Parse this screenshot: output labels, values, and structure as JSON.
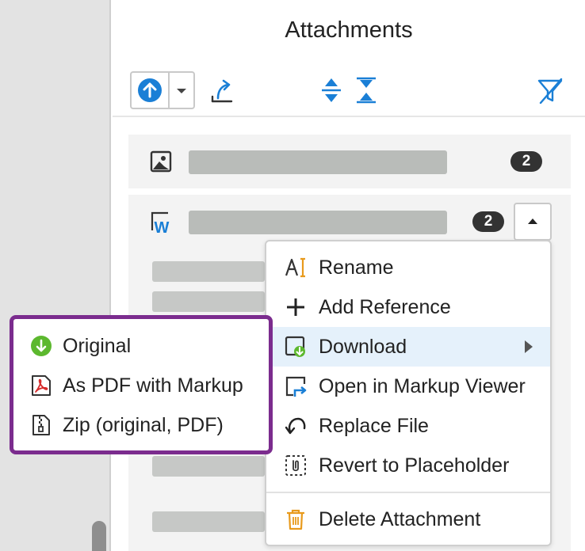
{
  "panel": {
    "title": "Attachments"
  },
  "toolbar": {
    "icons": [
      "upload-icon",
      "chevron-down-icon",
      "share-arrow-icon",
      "expand-all-icon",
      "collapse-all-icon",
      "filter-icon"
    ],
    "accent_color": "#1a7fd6"
  },
  "attachments": [
    {
      "type": "image-icon",
      "count": "2"
    },
    {
      "type": "word-doc-icon",
      "count": "2"
    }
  ],
  "context_menu": {
    "items": [
      {
        "label": "Rename",
        "icon": "rename-icon"
      },
      {
        "label": "Add Reference",
        "icon": "plus-icon"
      },
      {
        "label": "Download",
        "icon": "download-icon",
        "has_submenu": true,
        "active": true
      },
      {
        "label": "Open in Markup Viewer",
        "icon": "open-markup-icon"
      },
      {
        "label": "Replace File",
        "icon": "replace-icon"
      },
      {
        "label": "Revert to Placeholder",
        "icon": "placeholder-icon"
      },
      {
        "label": "Delete Attachment",
        "icon": "trash-icon"
      }
    ]
  },
  "download_submenu": {
    "highlight_color": "#7b2c8e",
    "items": [
      {
        "label": "Original",
        "icon": "download-circle-icon"
      },
      {
        "label": "As PDF with Markup",
        "icon": "pdf-icon"
      },
      {
        "label": "Zip (original, PDF)",
        "icon": "zip-icon"
      }
    ]
  }
}
